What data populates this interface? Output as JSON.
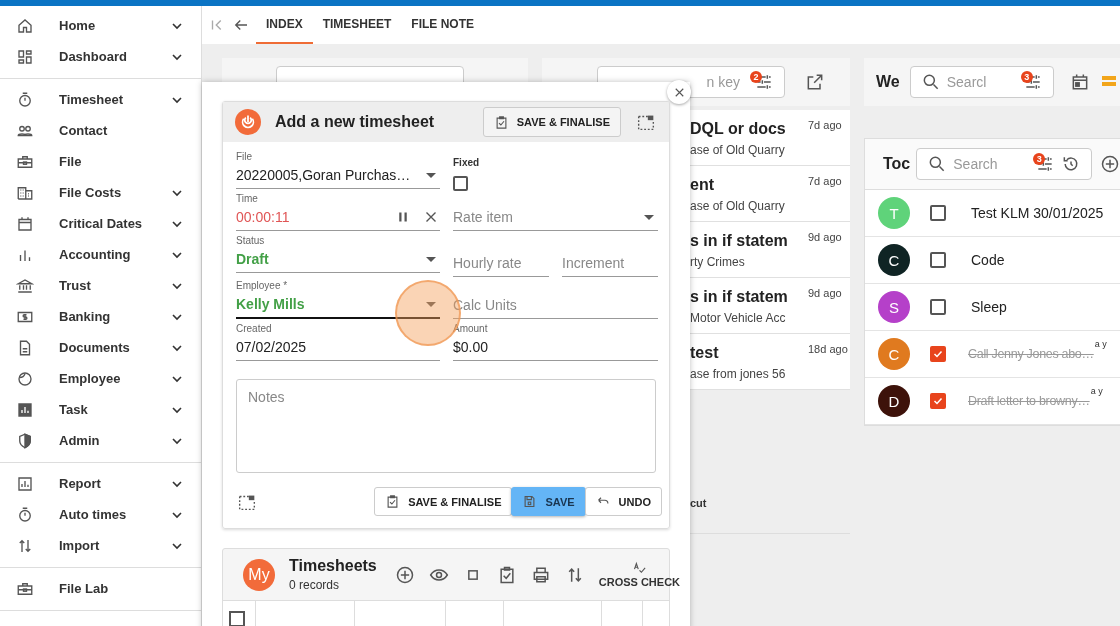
{
  "sidebar": {
    "groups": [
      [
        {
          "label": "Home",
          "expandable": true
        },
        {
          "label": "Dashboard",
          "expandable": true
        }
      ],
      [
        {
          "label": "Timesheet",
          "expandable": true
        },
        {
          "label": "Contact",
          "expandable": false
        },
        {
          "label": "File",
          "expandable": false
        },
        {
          "label": "File Costs",
          "expandable": true
        },
        {
          "label": "Critical Dates",
          "expandable": true
        },
        {
          "label": "Accounting",
          "expandable": true
        },
        {
          "label": "Trust",
          "expandable": true
        },
        {
          "label": "Banking",
          "expandable": true
        },
        {
          "label": "Documents",
          "expandable": true
        },
        {
          "label": "Employee",
          "expandable": true
        },
        {
          "label": "Task",
          "expandable": true
        },
        {
          "label": "Admin",
          "expandable": true
        }
      ],
      [
        {
          "label": "Report",
          "expandable": true
        },
        {
          "label": "Auto times",
          "expandable": true
        },
        {
          "label": "Import",
          "expandable": true
        }
      ],
      [
        {
          "label": "File Lab",
          "expandable": false
        }
      ]
    ]
  },
  "tabs": [
    {
      "label": "INDEX",
      "selected": true
    },
    {
      "label": "TIMESHEET",
      "selected": false
    },
    {
      "label": "FILE NOTE",
      "selected": false
    }
  ],
  "recent_panel": {
    "search_placeholder": "n key",
    "filter_badge": "2",
    "footer_text": "cut",
    "items": [
      {
        "title": "DQL or docs",
        "subtitle": "ase of Old Quarry",
        "time": "7d ago"
      },
      {
        "title": "ent",
        "subtitle": "ase of Old Quarry",
        "time": "7d ago"
      },
      {
        "title": "s in if statem",
        "subtitle": "rty Crimes",
        "time": "9d ago"
      },
      {
        "title": "s in if statem",
        "subtitle": "Motor Vehicle Acc",
        "time": "9d ago"
      },
      {
        "title": "test",
        "subtitle": "ase from jones 56",
        "time": "18d ago"
      }
    ]
  },
  "week_panel": {
    "title": "We",
    "search_placeholder": "Searcl",
    "filter_badge": "3"
  },
  "todo_panel": {
    "title": "Toc",
    "search_placeholder": "Search",
    "filter_badge": "3",
    "items": [
      {
        "initial": "T",
        "color": "#5fd37a",
        "text": "Test KLM 30/01/2025",
        "checked": false
      },
      {
        "initial": "C",
        "color": "#0f2424",
        "text": "Code",
        "checked": false
      },
      {
        "initial": "S",
        "color": "#b540c9",
        "text": "Sleep",
        "checked": false
      },
      {
        "initial": "C",
        "color": "#e07a1f",
        "text": "Call Jenny Jones abo…",
        "checked": true,
        "time": "a y"
      },
      {
        "initial": "D",
        "color": "#3d120a",
        "text": "Draft letter to browny…",
        "checked": true,
        "time": "a y"
      }
    ]
  },
  "dialog": {
    "title": "Add a new timesheet",
    "header_button": "SAVE & FINALISE",
    "file": {
      "label": "File",
      "value": "20220005,Goran Purchas…"
    },
    "fixed": {
      "label": "Fixed",
      "checked": false
    },
    "time": {
      "label": "Time",
      "value": "00:00:11"
    },
    "rate_item": {
      "placeholder": "Rate item"
    },
    "status": {
      "label": "Status",
      "value": "Draft"
    },
    "hourly_rate": {
      "placeholder": "Hourly rate"
    },
    "increment": {
      "placeholder": "Increment"
    },
    "employee": {
      "label": "Employee *",
      "value": "Kelly Mills",
      "focused": true
    },
    "calc_units": {
      "placeholder": "Calc Units"
    },
    "created": {
      "label": "Created",
      "value": "07/02/2025"
    },
    "amount": {
      "label": "Amount",
      "value": "$0.00"
    },
    "notes": {
      "placeholder": "Notes"
    },
    "buttons": [
      {
        "label": "SAVE & FINALISE",
        "kind": "outline"
      },
      {
        "label": "SAVE",
        "kind": "primary"
      },
      {
        "label": "UNDO",
        "kind": "outline"
      }
    ]
  },
  "timesheets": {
    "avatar": "My",
    "title": "Timesheets",
    "subtitle": "0 records",
    "cross_check": "CROSS CHECK",
    "select_all_checked": false
  }
}
